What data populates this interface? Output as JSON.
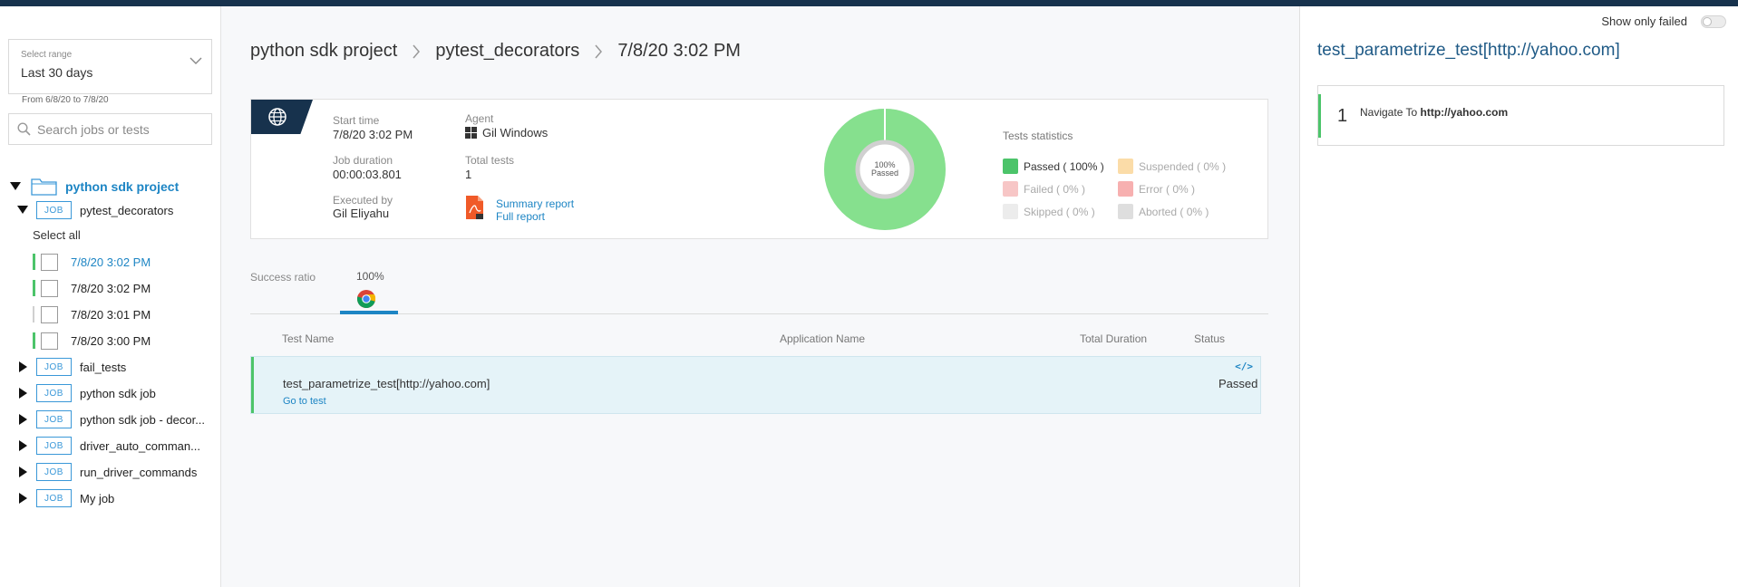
{
  "sidebar": {
    "range_label": "Select range",
    "range_value": "Last 30 days",
    "range_dates": "From 6/8/20 to 7/8/20",
    "search_placeholder": "Search jobs or tests",
    "project_name": "python sdk project",
    "job_badge": "JOB",
    "open_job": "pytest_decorators",
    "select_all": "Select all",
    "runs": [
      {
        "label": "7/8/20 3:02 PM",
        "status_color": "#4cc46a"
      },
      {
        "label": "7/8/20 3:02 PM",
        "status_color": "#4cc46a"
      },
      {
        "label": "7/8/20 3:01 PM",
        "status_color": "#d0d0d0"
      },
      {
        "label": "7/8/20 3:00 PM",
        "status_color": "#4cc46a"
      }
    ],
    "jobs": [
      "fail_tests",
      "python sdk job",
      "python sdk job - decor...",
      "driver_auto_comman...",
      "run_driver_commands",
      "My job"
    ]
  },
  "breadcrumb": {
    "project": "python sdk project",
    "job": "pytest_decorators",
    "run": "7/8/20 3:02 PM"
  },
  "job_info": {
    "start_time_label": "Start time",
    "start_time": "7/8/20 3:02 PM",
    "duration_label": "Job duration",
    "duration": "00:00:03.801",
    "executed_by_label": "Executed by",
    "executed_by": "Gil Eliyahu",
    "agent_label": "Agent",
    "agent": "Gil Windows",
    "total_tests_label": "Total tests",
    "total_tests": "1",
    "summary_report": "Summary report",
    "full_report": "Full report"
  },
  "donut": {
    "passed_fraction": 1.0,
    "pct_text": "100%",
    "label": "Passed",
    "color": "#86e08e"
  },
  "stats": {
    "title": "Tests statistics",
    "passed": "Passed ( 100% )",
    "failed": "Failed ( 0% )",
    "skipped": "Skipped ( 0% )",
    "suspended": "Suspended ( 0% )",
    "error": "Error ( 0% )",
    "aborted": "Aborted ( 0% )",
    "colors": {
      "passed": "#4cc46a",
      "failed": "#f7c6c6",
      "skipped": "#ececec",
      "suspended": "#fbdca8",
      "error": "#f7b0b0",
      "aborted": "#dedede"
    }
  },
  "tabs": {
    "success_ratio_label": "Success ratio",
    "browser_pct": "100%"
  },
  "table": {
    "headers": {
      "test_name": "Test Name",
      "application_name": "Application Name",
      "total_duration": "Total Duration",
      "status": "Status"
    },
    "row": {
      "test_name": "test_parametrize_test[http://yahoo.com]",
      "go_to_test": "Go to test",
      "status": "Passed"
    }
  },
  "right_panel": {
    "show_only_failed": "Show only failed",
    "title": "test_parametrize_test[http://yahoo.com]",
    "step": {
      "number": "1",
      "text": "Navigate To",
      "url": "http://yahoo.com"
    }
  }
}
